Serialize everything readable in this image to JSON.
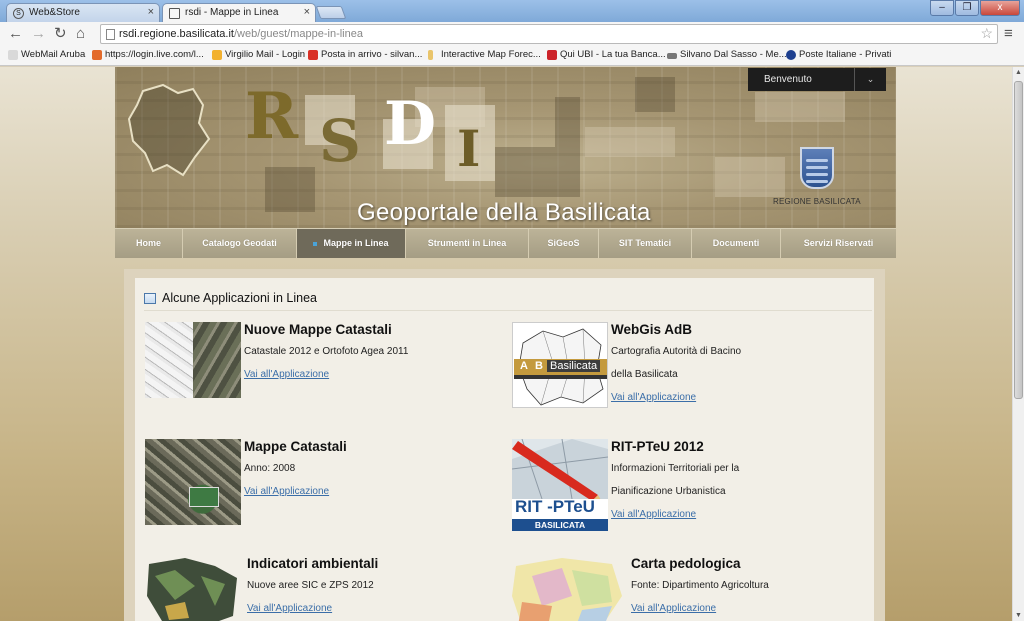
{
  "browser": {
    "tabs": [
      {
        "label": "Web&Store",
        "active": false
      },
      {
        "label": "rsdi - Mappe in Linea",
        "active": true
      }
    ],
    "url_host": "rsdi.regione.basilicata.it",
    "url_path": "/web/guest/mappe-in-linea",
    "bookmarks": [
      {
        "label": "WebMail Aruba",
        "icon": "aruba-icon",
        "color": "#d9d9d9"
      },
      {
        "label": "https://login.live.com/l...",
        "icon": "windows-icon",
        "color": "#e36b2b"
      },
      {
        "label": "Virgilio Mail - Login",
        "icon": "virgilio-icon",
        "color": "#f2b12f"
      },
      {
        "label": "Posta in arrivo - silvan...",
        "icon": "gmail-icon",
        "color": "#d93025"
      },
      {
        "label": "Interactive Map Forec...",
        "icon": "candle-icon",
        "color": "#e9c46a"
      },
      {
        "label": "Qui UBI - La tua Banca...",
        "icon": "ubi-icon",
        "color": "#cc2229"
      },
      {
        "label": "Silvano Dal Sasso - Me...",
        "icon": "hat-icon",
        "color": "#777777"
      },
      {
        "label": "Poste Italiane - Privati",
        "icon": "poste-icon",
        "color": "#1d3f8f"
      }
    ]
  },
  "site": {
    "logo_letters": [
      "R",
      "S",
      "D",
      "I"
    ],
    "title": "Geoportale della Basilicata",
    "region_label": "REGIONE BASILICATA",
    "welcome": "Benvenuto",
    "nav": [
      {
        "label": "Home",
        "active": false
      },
      {
        "label": "Catalogo Geodati",
        "active": false
      },
      {
        "label": "Mappe in Linea",
        "active": true
      },
      {
        "label": "Strumenti in Linea",
        "active": false
      },
      {
        "label": "SiGeoS",
        "active": false
      },
      {
        "label": "SIT Tematici",
        "active": false
      },
      {
        "label": "Documenti",
        "active": false
      },
      {
        "label": "Servizi Riservati",
        "active": false
      }
    ]
  },
  "section": {
    "title": "Alcune Applicazioni in Linea",
    "apps": [
      {
        "title": "Nuove Mappe Catastali",
        "lines": [
          "Catastale 2012 e Ortofoto Agea 2011"
        ],
        "link": "Vai all'Applicazione"
      },
      {
        "title": "WebGis AdB",
        "lines": [
          "Cartografia Autorità di Bacino",
          "della Basilicata"
        ],
        "link": "Vai all'Applicazione",
        "thumb_text_a": "A",
        "thumb_text_b": "B",
        "thumb_text": "Basilicata"
      },
      {
        "title": "Mappe Catastali",
        "lines": [
          "Anno: 2008"
        ],
        "link": "Vai all'Applicazione"
      },
      {
        "title": "RIT-PTeU 2012",
        "lines": [
          "Informazioni Territoriali per la",
          "Pianificazione Urbanistica"
        ],
        "link": "Vai all'Applicazione",
        "thumb_text": "RIT -PTeU",
        "thumb_sub": "BASILICATA"
      },
      {
        "title": "Indicatori ambientali",
        "lines": [
          "Nuove aree SIC e ZPS 2012"
        ],
        "link": "Vai all'Applicazione"
      },
      {
        "title": "Carta pedologica",
        "lines": [
          "Fonte: Dipartimento Agricoltura"
        ],
        "link": "Vai all'Applicazione"
      }
    ]
  }
}
